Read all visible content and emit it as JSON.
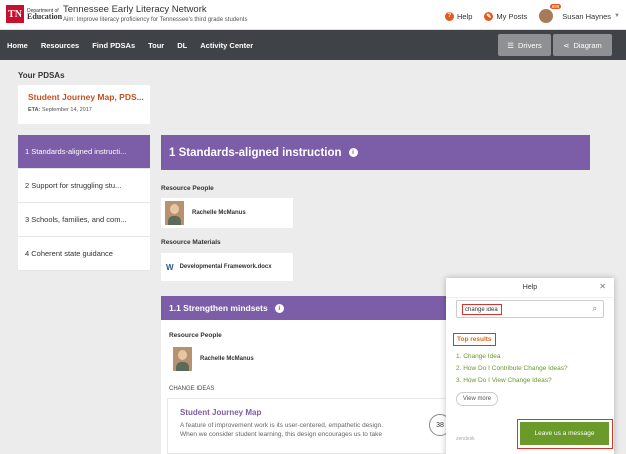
{
  "header": {
    "logo_tn": "TN",
    "logo_dept": "Department of",
    "logo_edu": "Education",
    "site_title": "Tennessee Early Literacy Network",
    "aim": "Aim: Improve literacy proficiency for Tennessee's third grade students",
    "help_label": "Help",
    "my_posts_label": "My Posts",
    "user_name": "Susan Haynes",
    "notification_count": "999"
  },
  "nav": {
    "items": [
      "Home",
      "Resources",
      "Find PDSAs",
      "Tour",
      "DL",
      "Activity Center"
    ],
    "drivers_label": "Drivers",
    "diagram_label": "Diagram"
  },
  "pdsas": {
    "heading": "Your PDSAs",
    "card_title": "Student Journey Map, PDS...",
    "eta_label": "ETA:",
    "eta_date": "September 14, 2017"
  },
  "drivers": [
    "1 Standards-aligned instructi...",
    "2 Support for struggling stu...",
    "3 Schools, families, and com...",
    "4 Coherent state guidance"
  ],
  "main": {
    "driver_title": "1 Standards-aligned instruction",
    "resource_people_label": "Resource People",
    "person_name": "Rachelle McManus",
    "resource_materials_label": "Resource Materials",
    "material_name": "Developmental Framework.docx",
    "sub_title": "1.1 Strengthen mindsets",
    "sub_resource_people_label": "Resource People",
    "sub_person_name": "Rachelle McManus",
    "change_ideas_label": "CHANGE IDEAS",
    "journey_title": "Student Journey Map",
    "journey_desc_1": "A feature of improvement work is its user-centered, empathetic design.",
    "journey_desc_2": "When we consider student learning, this design encourages us to take",
    "count": "38"
  },
  "help": {
    "title": "Help",
    "search_value": "change idea",
    "top_results_label": "Top results",
    "results": [
      "1. Change Idea",
      "2. How Do I Contribute Change Ideas?",
      "3. How Do I View Change Ideas?"
    ],
    "view_more": "View more",
    "zendesk": "zendesk",
    "leave_message": "Leave us a message"
  },
  "colors": {
    "purple": "#7b5ea7",
    "orange": "#c5511f",
    "green": "#6a9a2a",
    "nav_dark": "#3f4348",
    "highlight_red": "#d9342b"
  }
}
